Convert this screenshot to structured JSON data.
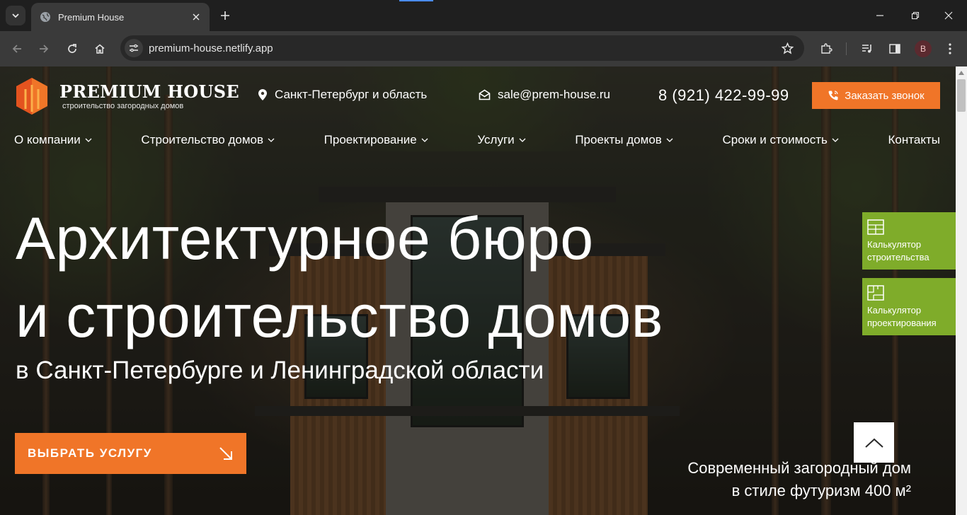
{
  "browser": {
    "tab_title": "Premium House",
    "url": "premium-house.netlify.app",
    "avatar_letter": "B"
  },
  "header": {
    "logo_title": "PREMIUM HOUSE",
    "logo_subtitle": "строительство загородных домов",
    "location": "Санкт-Петербург и область",
    "email": "sale@prem-house.ru",
    "phone": "8 (921) 422-99-99",
    "call_button": "Заказать звонок"
  },
  "nav": {
    "items": [
      {
        "label": "О компании",
        "dropdown": true
      },
      {
        "label": "Строительство домов",
        "dropdown": true
      },
      {
        "label": "Проектирование",
        "dropdown": true
      },
      {
        "label": "Услуги",
        "dropdown": true
      },
      {
        "label": "Проекты домов",
        "dropdown": true
      },
      {
        "label": "Сроки и стоимость",
        "dropdown": true
      },
      {
        "label": "Контакты",
        "dropdown": false
      }
    ]
  },
  "hero": {
    "title_line1": "Архитектурное бюро",
    "title_line2": "и строительство домов",
    "subtitle": "в Санкт-Петербурге и Ленинградской области",
    "cta_label": "ВЫБРАТЬ УСЛУГУ",
    "caption_line1": "Современный загородный дом",
    "caption_line2": "в стиле футуризм 400 м²"
  },
  "side_widgets": [
    {
      "line1": "Калькулятор",
      "line2": "строительства",
      "icon": "grid-plan-icon"
    },
    {
      "line1": "Калькулятор",
      "line2": "проектирования",
      "icon": "floor-plan-icon"
    }
  ],
  "colors": {
    "accent_orange": "#f07528",
    "widget_green": "#7fac2a"
  }
}
